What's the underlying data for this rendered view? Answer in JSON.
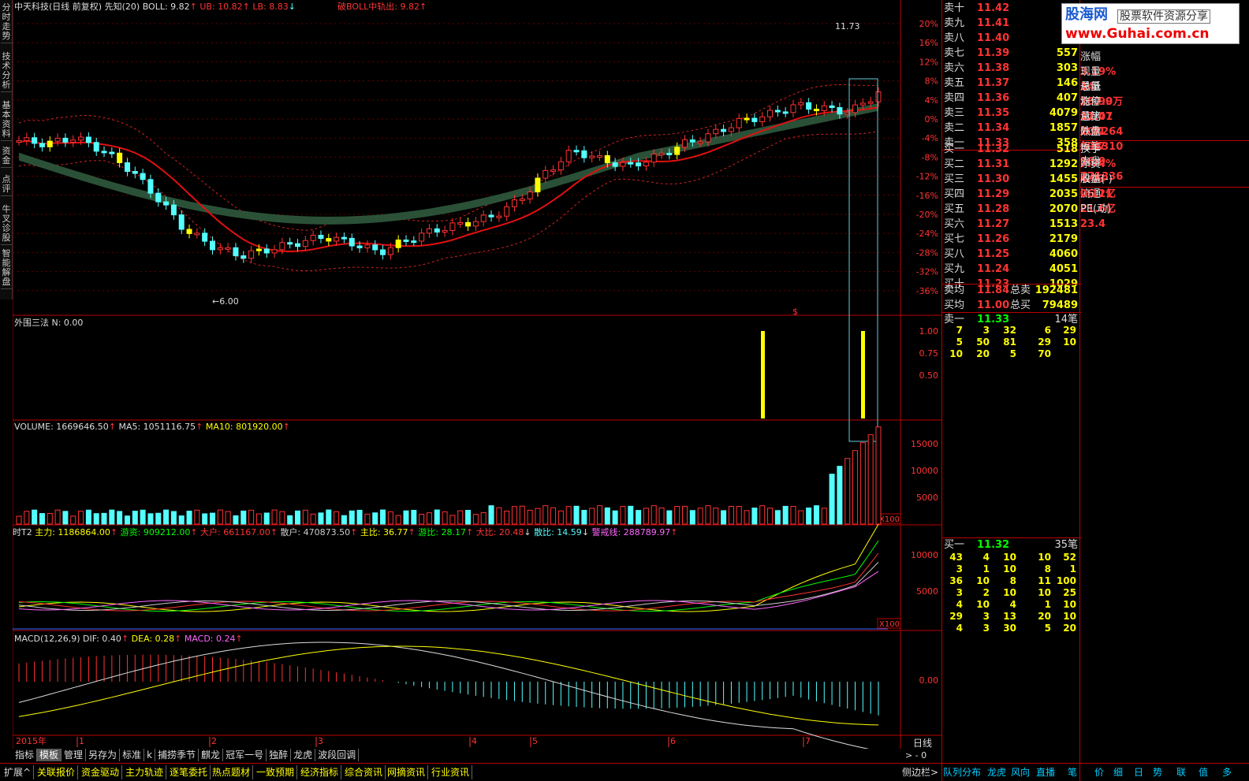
{
  "left_tabs": [
    "分时走势",
    "技术分析",
    "基本资料",
    "资金",
    "点评",
    "牛叉诊股",
    "智能解盘"
  ],
  "header": {
    "name": "中天科技",
    "mode": "(日线 前复权)",
    "ind": "先知(20)",
    "boll": "BOLL: 9.82",
    "ub": "UB: 10.82",
    "lb": "LB: 8.83",
    "cross": "破BOLL中轨出: 9.82"
  },
  "price_axis": [
    "20%",
    "16%",
    "12%",
    "8%",
    "4%",
    "0%",
    "-4%",
    "-8%",
    "-12%",
    "-16%",
    "-20%",
    "-24%",
    "-28%",
    "-32%",
    "-36%"
  ],
  "labels": {
    "high": "11.73",
    "low": "6.00",
    "dollar": "$"
  },
  "panel2": {
    "title": "外围三法  N: 0.00",
    "ticks": [
      "1.00",
      "0.75",
      "0.50"
    ]
  },
  "panel3": {
    "vol": "VOLUME: 1669646.50",
    "ma5": "MA5: 1051116.75",
    "ma10": "MA10: 801920.00",
    "ticks": [
      "15000",
      "10000",
      "5000"
    ],
    "unit": "X100"
  },
  "panel4": {
    "name": "时T2",
    "main": "主力: 1186864.00",
    "hot": "游资: 909212.00",
    "big": "大户: 661167.00",
    "retail": "散户: 470873.50",
    "mainr": "主比: 36.77",
    "hotr": "游比: 28.17",
    "bigr": "大比: 20.48",
    "retr": "散比: 14.59",
    "warn": "警戒线: 288789.97",
    "ticks": [
      "10000",
      "5000"
    ],
    "unit": "X100"
  },
  "panel5": {
    "name": "MACD(12,26,9)",
    "dif": "DIF: 0.40",
    "dea": "DEA: 0.28",
    "macd": "MACD: 0.24",
    "tick": "0.00"
  },
  "timeaxis": {
    "year": "2015年",
    "months": [
      "1",
      "2",
      "3",
      "4",
      "5",
      "6",
      "7"
    ],
    "period": "日线"
  },
  "bottom_tabs": [
    "指标",
    "模板",
    "管理",
    "另存为",
    "标准",
    "k",
    "捕捞季节",
    "麒龙",
    "冠军一号",
    "独醉",
    "龙虎",
    "波段回调"
  ],
  "bottom_bar": [
    "扩展^",
    "关联报价",
    "资金驱动",
    "主力轨迹",
    "逐笔委托",
    "热点题材",
    "一致预期",
    "经济指标",
    "综合资讯",
    "网摘资讯",
    "行业资讯"
  ],
  "right_bottom": [
    "侧边栏>",
    "队列",
    "分布",
    "龙虎",
    "风向",
    "直播",
    "笔",
    "价",
    "细",
    "日",
    "势",
    "联",
    "值",
    "多"
  ],
  "asks": [
    [
      "卖十",
      "11.42",
      "1"
    ],
    [
      "卖九",
      "11.41",
      "1"
    ],
    [
      "卖八",
      "11.40",
      "1"
    ],
    [
      "卖七",
      "11.39",
      "557"
    ],
    [
      "卖六",
      "11.38",
      "303"
    ],
    [
      "卖五",
      "11.37",
      "146"
    ],
    [
      "卖四",
      "11.36",
      "407"
    ],
    [
      "卖三",
      "11.35",
      "4079"
    ],
    [
      "卖二",
      "11.34",
      "1857"
    ],
    [
      "卖一",
      "11.33",
      "358"
    ]
  ],
  "bids": [
    [
      "买一",
      "11.32",
      "518"
    ],
    [
      "买二",
      "11.31",
      "1292"
    ],
    [
      "买三",
      "11.30",
      "1455"
    ],
    [
      "买四",
      "11.29",
      "2035"
    ],
    [
      "买五",
      "11.28",
      "2070"
    ],
    [
      "买六",
      "11.27",
      "1513"
    ],
    [
      "买七",
      "11.26",
      "2179"
    ],
    [
      "买八",
      "11.25",
      "4060"
    ],
    [
      "买九",
      "11.24",
      "4051"
    ],
    [
      "买十",
      "11.23",
      "1029"
    ]
  ],
  "summary": [
    [
      "卖均",
      "11.84",
      "总卖",
      "192481"
    ],
    [
      "买均",
      "11.00",
      "总买",
      "79489"
    ]
  ],
  "stats": [
    [
      "涨幅",
      "3.19%",
      "最低",
      "10.99"
    ],
    [
      "现量",
      "14",
      "均价",
      "11.41"
    ],
    [
      "总量",
      "167.0万",
      "量比",
      "2.01"
    ],
    [
      "涨停",
      "12.07",
      "跌停",
      "9.87"
    ],
    [
      "总笔",
      "104264",
      "每笔",
      "16.0"
    ],
    [
      "外盘",
      "898310",
      "内盘",
      "771336"
    ],
    [
      "换手",
      "7.74%",
      "股本",
      "26.1亿"
    ],
    [
      "净资",
      "4.03",
      "流通",
      "21.6亿"
    ],
    [
      "收益(-)",
      "0.121",
      "PE(动)",
      "23.4"
    ]
  ],
  "logo": {
    "line1": "股海网",
    "line1b": "股票软件资源分享",
    "line2": "www.Guhai.com.cn"
  },
  "sell1": {
    "label": "卖一",
    "price": "11.33",
    "count": "14笔"
  },
  "sell_ticks": [
    [
      "7",
      "3",
      "32",
      "6",
      "29"
    ],
    [
      "5",
      "50",
      "81",
      "29",
      "10"
    ],
    [
      "10",
      "20",
      "5",
      "70",
      ""
    ]
  ],
  "buy1": {
    "label": "买一",
    "price": "11.32",
    "count": "35笔"
  },
  "buy_ticks": [
    [
      "43",
      "4",
      "10",
      "10",
      "52"
    ],
    [
      "3",
      "1",
      "10",
      "8",
      "1"
    ],
    [
      "36",
      "10",
      "8",
      "11",
      "100"
    ],
    [
      "3",
      "2",
      "10",
      "10",
      "25"
    ],
    [
      "4",
      "10",
      "4",
      "1",
      "10"
    ],
    [
      "29",
      "3",
      "13",
      "20",
      "10"
    ],
    [
      "4",
      "3",
      "30",
      "5",
      "20"
    ]
  ],
  "colors": {
    "up": "#ff3232",
    "down": "#54ffff",
    "yellow": "#ffff00",
    "ma": "#e01010"
  }
}
